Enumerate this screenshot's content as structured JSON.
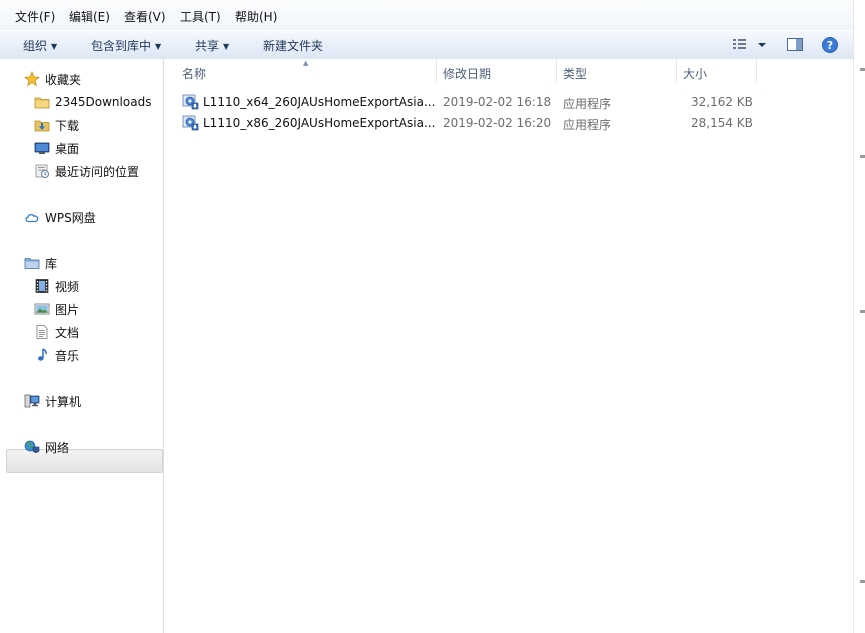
{
  "menubar": {
    "items": [
      "文件(F)",
      "编辑(E)",
      "查看(V)",
      "工具(T)",
      "帮助(H)"
    ]
  },
  "toolbar": {
    "organize": "组织",
    "include_in_library": "包含到库中",
    "share": "共享",
    "new_folder": "新建文件夹",
    "icons": [
      "view-details-icon",
      "preview-pane-icon",
      "help-icon"
    ]
  },
  "nav": {
    "favorites": {
      "label": "收藏夹",
      "items": [
        "2345Downloads",
        "下载",
        "桌面",
        "最近访问的位置"
      ]
    },
    "wps": "WPS网盘",
    "libraries": {
      "label": "库",
      "items": [
        "视频",
        "图片",
        "文档",
        "音乐"
      ]
    },
    "computer": "计算机",
    "network": "网络"
  },
  "columns": {
    "name": "名称",
    "modified": "修改日期",
    "type": "类型",
    "size": "大小"
  },
  "files": [
    {
      "name": "L1110_x64_260JAUsHomeExportAsia...",
      "modified": "2019-02-02 16:18",
      "type": "应用程序",
      "size": "32,162 KB"
    },
    {
      "name": "L1110_x86_260JAUsHomeExportAsia...",
      "modified": "2019-02-02 16:20",
      "type": "应用程序",
      "size": "28,154 KB"
    }
  ]
}
